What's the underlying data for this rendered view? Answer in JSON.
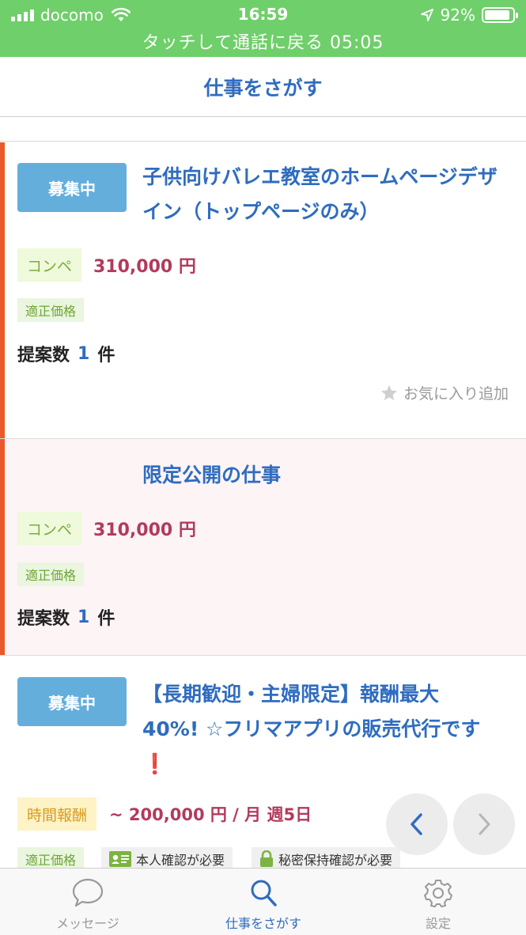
{
  "status_bar": {
    "carrier": "docomo",
    "time": "16:59",
    "battery": "92%",
    "battery_level": 0.92,
    "call_banner": "タッチして通話に戻る 05:05"
  },
  "header": {
    "title": "仕事をさがす"
  },
  "jobs": [
    {
      "status_badge": "募集中",
      "title": "子供向けバレエ教室のホームページデザイン（トップページのみ）",
      "type_label": "コンペ",
      "price": "310,000 円",
      "fair_price_label": "適正価格",
      "proposals_label": "提案数",
      "proposals_count": "1",
      "proposals_unit": "件",
      "favorite_label": "お気に入り追加"
    },
    {
      "title": "限定公開の仕事",
      "type_label": "コンペ",
      "price": "310,000 円",
      "fair_price_label": "適正価格",
      "proposals_label": "提案数",
      "proposals_count": "1",
      "proposals_unit": "件"
    },
    {
      "status_badge": "募集中",
      "title_line1": "【長期歓迎・主婦限定】報酬最大",
      "title_line2": "40%! ☆フリマアプリの販売代行です",
      "title_mark": "❗",
      "type_label": "時間報酬",
      "price": "~ 200,000 円 / 月 週5日",
      "fair_price_label": "適正価格",
      "identity_label": "本人確認が必要",
      "nda_label": "秘密保持確認が必要"
    }
  ],
  "tabs": [
    {
      "label": "メッセージ",
      "icon": "speech-bubble-icon",
      "active": false
    },
    {
      "label": "仕事をさがす",
      "icon": "search-icon",
      "active": true
    },
    {
      "label": "設定",
      "icon": "gear-icon",
      "active": false
    }
  ],
  "colors": {
    "status_bar": "#6fcf6a",
    "accent_blue": "#2f6cbf",
    "badge_blue": "#64aedc",
    "price_red": "#b33a5c",
    "card_accent": "#e9592b"
  }
}
